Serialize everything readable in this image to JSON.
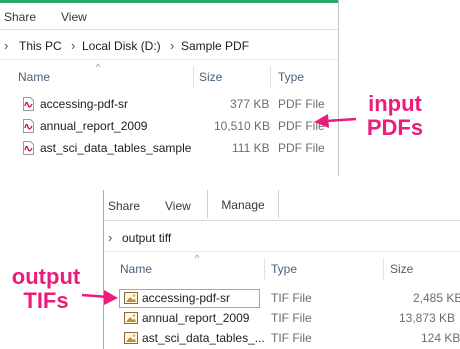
{
  "top_window": {
    "ribbon_tabs": [
      "Share",
      "View"
    ],
    "breadcrumb": [
      "This PC",
      "Local Disk (D:)",
      "Sample PDF"
    ],
    "columns": {
      "name": "Name",
      "size": "Size",
      "type": "Type"
    },
    "files": [
      {
        "name": "accessing-pdf-sr",
        "size": "377 KB",
        "type": "PDF File",
        "icon": "pdf-file-icon"
      },
      {
        "name": "annual_report_2009",
        "size": "10,510 KB",
        "type": "PDF File",
        "icon": "pdf-file-icon"
      },
      {
        "name": "ast_sci_data_tables_sample",
        "size": "111 KB",
        "type": "PDF File",
        "icon": "pdf-file-icon"
      }
    ]
  },
  "bottom_window": {
    "ribbon_tabs": [
      "Share",
      "View",
      "Manage"
    ],
    "breadcrumb": [
      "output tiff"
    ],
    "columns": {
      "name": "Name",
      "type": "Type",
      "size": "Size"
    },
    "files": [
      {
        "name": "accessing-pdf-sr",
        "type": "TIF File",
        "size": "2,485 KB",
        "icon": "tif-image-icon"
      },
      {
        "name": "annual_report_2009",
        "type": "TIF File",
        "size": "13,873 KB",
        "icon": "tif-image-icon"
      },
      {
        "name": "ast_sci_data_tables_...",
        "type": "TIF File",
        "size": "124 KB",
        "icon": "tif-image-icon"
      }
    ]
  },
  "annotations": {
    "input": [
      "input",
      "PDFs"
    ],
    "output": [
      "output",
      "TIFs"
    ],
    "color": "#ec1c7a"
  },
  "colors": {
    "accent_bar": "#2aa66a",
    "manage_tab": "#f5e98f",
    "header_text": "#4c607a"
  }
}
